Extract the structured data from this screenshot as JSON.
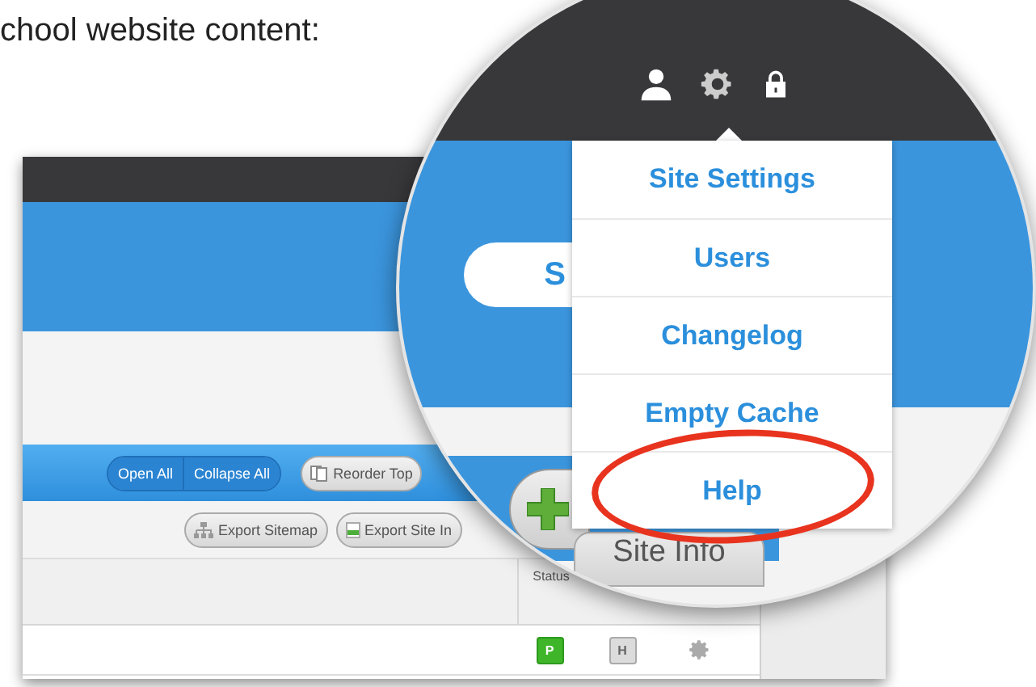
{
  "caption": "chool website content:",
  "page": {
    "view_buttons": [
      {
        "label": "Open All"
      },
      {
        "label": "Collapse All"
      }
    ],
    "reorder_button": "Reorder Top",
    "export_buttons": [
      {
        "label": "Export Sitemap",
        "kind": "sitemap"
      },
      {
        "label": "Export Site In",
        "kind": "site"
      }
    ],
    "table": {
      "status_column": "Status",
      "rows": [
        {
          "status": "P",
          "hidden": "H"
        }
      ]
    }
  },
  "magnifier": {
    "search": "S",
    "menu": [
      {
        "label": "Site Settings",
        "circled": false
      },
      {
        "label": "Users",
        "circled": false
      },
      {
        "label": "Changelog",
        "circled": false
      },
      {
        "label": "Empty Cache",
        "circled": false
      },
      {
        "label": "Help",
        "circled": true
      }
    ],
    "tab": "Site Info"
  }
}
